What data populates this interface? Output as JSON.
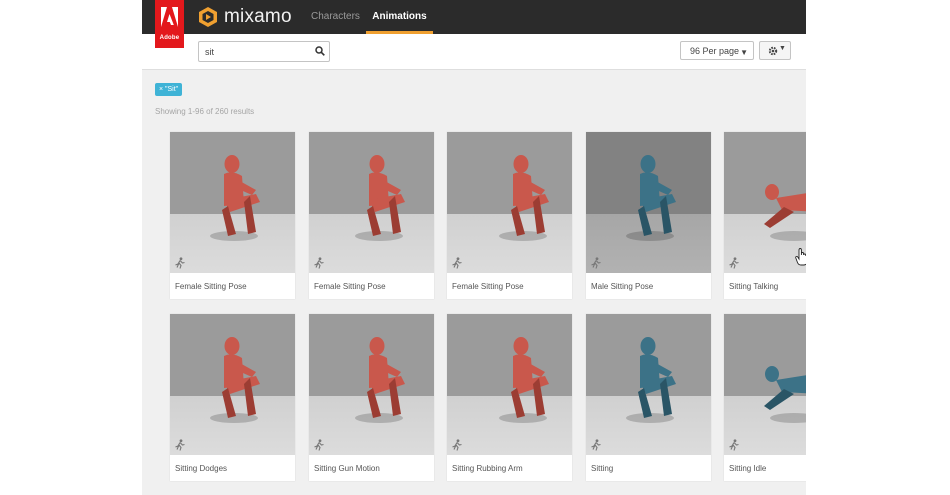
{
  "header": {
    "adobe_label": "Adobe",
    "brand": "mixamo",
    "tabs": [
      {
        "label": "Characters",
        "active": false
      },
      {
        "label": "Animations",
        "active": true
      }
    ],
    "accent_color": "#f0a030"
  },
  "search": {
    "value": "sit",
    "per_page": "96 Per page"
  },
  "filter_tag": "× \"Sit\"",
  "results_text": "Showing 1-96 of 260 results",
  "cards": [
    {
      "label": "Female Sitting Pose",
      "color": "red"
    },
    {
      "label": "Female Sitting Pose",
      "color": "red"
    },
    {
      "label": "Female Sitting Pose",
      "color": "red"
    },
    {
      "label": "Male Sitting Pose",
      "color": "blue"
    },
    {
      "label": "Sitting Talking",
      "color": "red"
    },
    {
      "label": "Sitting Dodges",
      "color": "red"
    },
    {
      "label": "Sitting Gun Motion",
      "color": "red"
    },
    {
      "label": "Sitting Rubbing Arm",
      "color": "red"
    },
    {
      "label": "Sitting",
      "color": "blue"
    },
    {
      "label": "Sitting Idle",
      "color": "blue"
    }
  ],
  "colors": {
    "female_figure": "#c9584c",
    "male_figure": "#3c7287",
    "filter_tag": "#3fb3d6"
  }
}
